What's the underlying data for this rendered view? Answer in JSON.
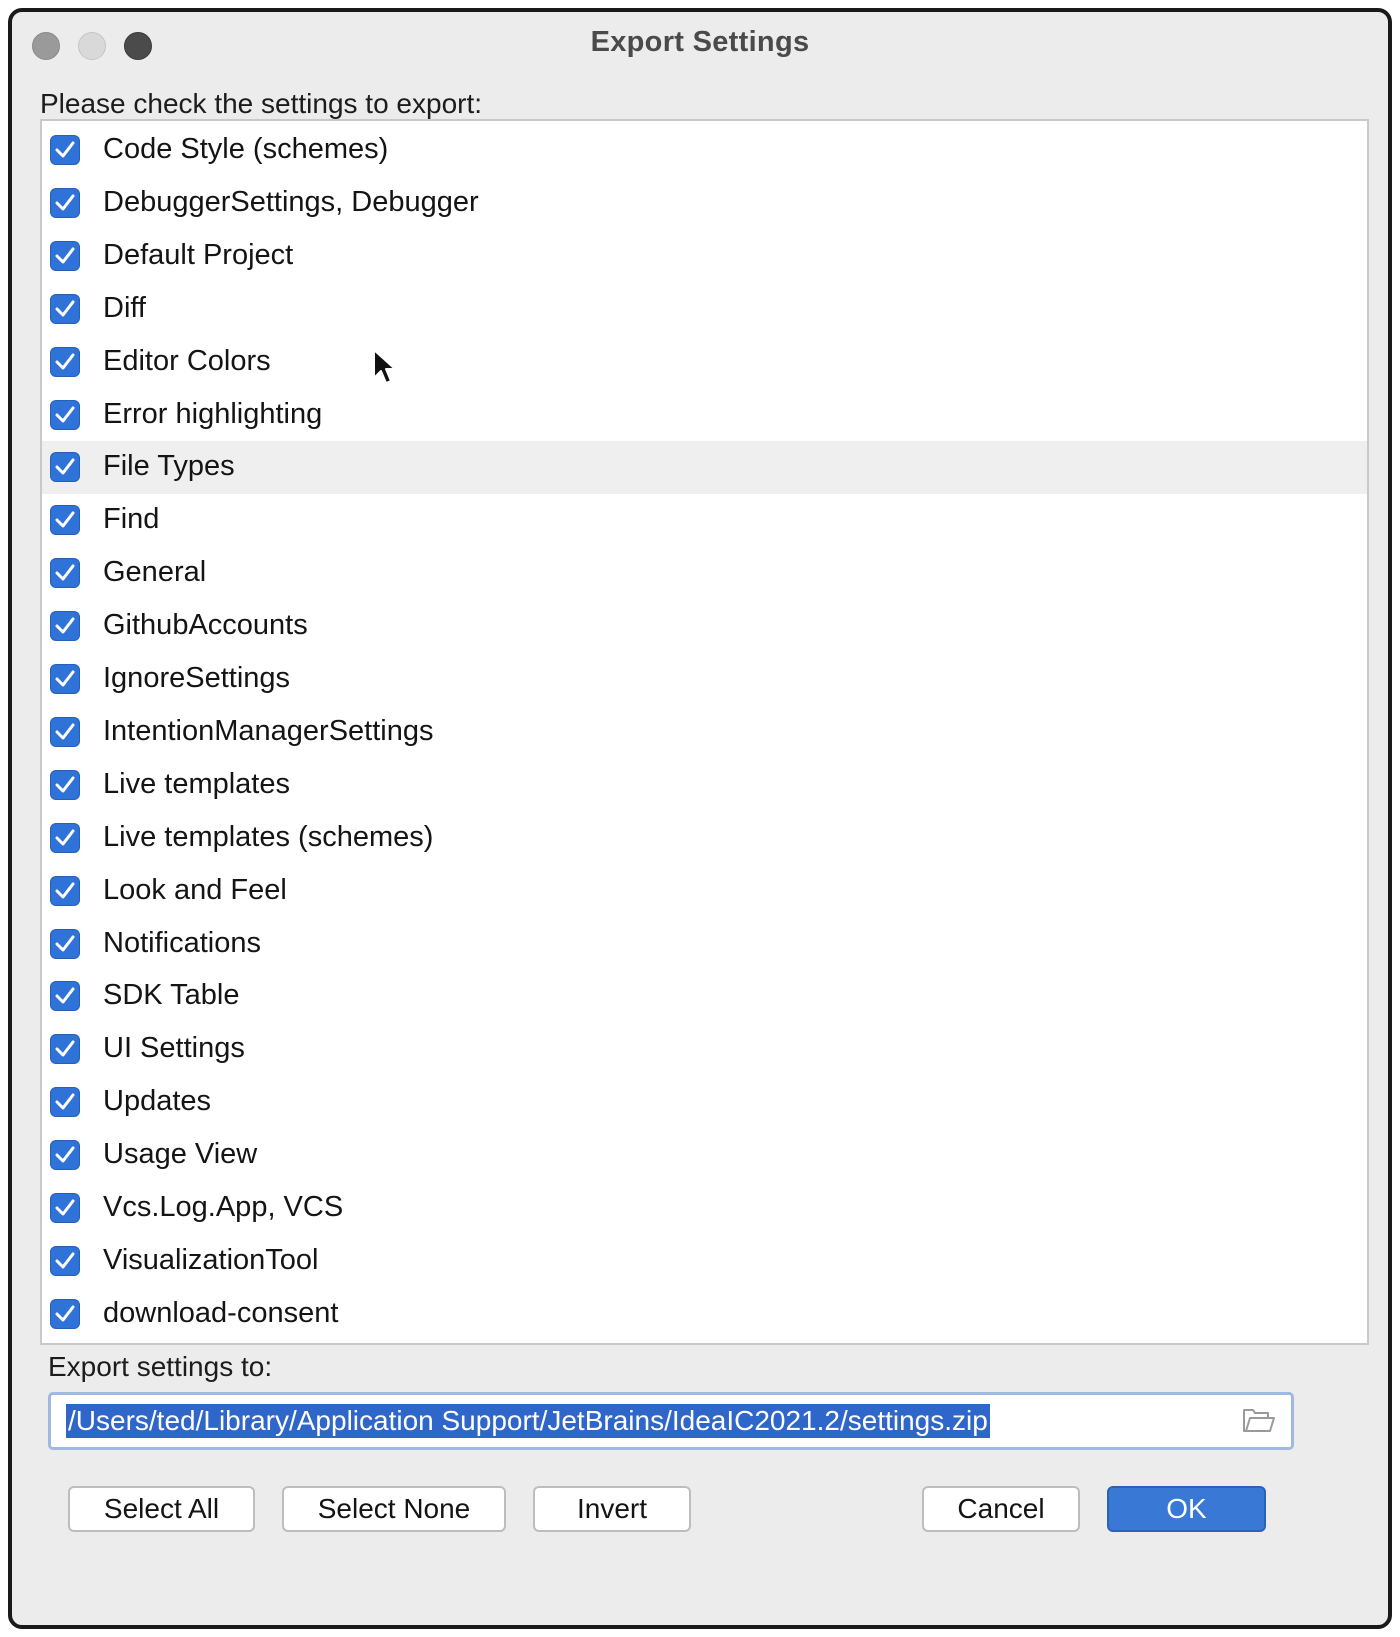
{
  "window": {
    "title": "Export Settings"
  },
  "prompt": "Please check the settings to export:",
  "settings_list": {
    "items": [
      {
        "label": "Code Style (schemes)",
        "checked": true
      },
      {
        "label": "DebuggerSettings, Debugger",
        "checked": true
      },
      {
        "label": "Default Project",
        "checked": true
      },
      {
        "label": "Diff",
        "checked": true
      },
      {
        "label": "Editor Colors",
        "checked": true
      },
      {
        "label": "Error highlighting",
        "checked": true
      },
      {
        "label": "File Types",
        "checked": true,
        "hovered": true
      },
      {
        "label": "Find",
        "checked": true
      },
      {
        "label": "General",
        "checked": true
      },
      {
        "label": "GithubAccounts",
        "checked": true
      },
      {
        "label": "IgnoreSettings",
        "checked": true
      },
      {
        "label": "IntentionManagerSettings",
        "checked": true
      },
      {
        "label": "Live templates",
        "checked": true
      },
      {
        "label": "Live templates (schemes)",
        "checked": true
      },
      {
        "label": "Look and Feel",
        "checked": true
      },
      {
        "label": "Notifications",
        "checked": true
      },
      {
        "label": "SDK Table",
        "checked": true
      },
      {
        "label": "UI Settings",
        "checked": true
      },
      {
        "label": "Updates",
        "checked": true
      },
      {
        "label": "Usage View",
        "checked": true
      },
      {
        "label": "Vcs.Log.App, VCS",
        "checked": true
      },
      {
        "label": "VisualizationTool",
        "checked": true
      },
      {
        "label": "download-consent",
        "checked": true
      }
    ]
  },
  "export": {
    "label": "Export settings to:",
    "path": "/Users/ted/Library/Application Support/JetBrains/IdeaIC2021.2/settings.zip",
    "browse_icon": "folder-icon"
  },
  "buttons": {
    "select_all": "Select All",
    "select_none": "Select None",
    "invert": "Invert",
    "cancel": "Cancel",
    "ok": "OK"
  },
  "colors": {
    "checkbox": "#2f73d8",
    "selection": "#2f66c9",
    "ok_button": "#3a78d6"
  }
}
